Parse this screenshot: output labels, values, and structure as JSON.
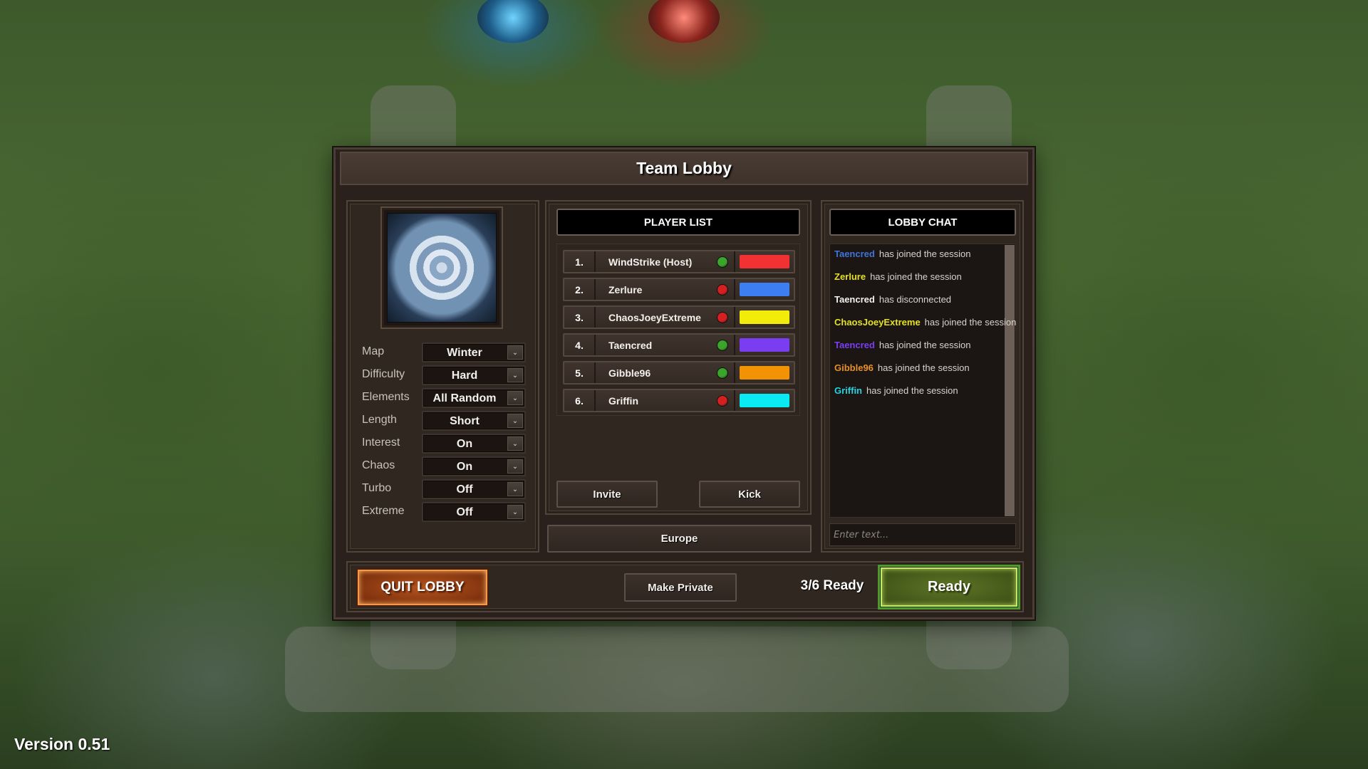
{
  "window": {
    "title": "Team Lobby"
  },
  "map_preview": {
    "name": "Winter"
  },
  "settings": [
    {
      "label": "Map",
      "value": "Winter"
    },
    {
      "label": "Difficulty",
      "value": "Hard"
    },
    {
      "label": "Elements",
      "value": "All Random"
    },
    {
      "label": "Length",
      "value": "Short"
    },
    {
      "label": "Interest",
      "value": "On"
    },
    {
      "label": "Chaos",
      "value": "On"
    },
    {
      "label": "Turbo",
      "value": "Off"
    },
    {
      "label": "Extreme",
      "value": "Off"
    }
  ],
  "player_list": {
    "header": "PLAYER LIST",
    "players": [
      {
        "num": "1.",
        "name": "WindStrike (Host)",
        "ready": true,
        "status_color": "#3aa52a",
        "team_color": "#f23232"
      },
      {
        "num": "2.",
        "name": "Zerlure",
        "ready": false,
        "status_color": "#d42020",
        "team_color": "#3d7ef2"
      },
      {
        "num": "3.",
        "name": "ChaosJoeyExtreme",
        "ready": false,
        "status_color": "#d42020",
        "team_color": "#f2ec0a"
      },
      {
        "num": "4.",
        "name": "Taencred",
        "ready": true,
        "status_color": "#3aa52a",
        "team_color": "#7a3df2"
      },
      {
        "num": "5.",
        "name": "Gibble96",
        "ready": true,
        "status_color": "#3aa52a",
        "team_color": "#f29205"
      },
      {
        "num": "6.",
        "name": "Griffin",
        "ready": false,
        "status_color": "#d42020",
        "team_color": "#0aeaf2"
      }
    ],
    "invite_label": "Invite",
    "kick_label": "Kick"
  },
  "region": "Europe",
  "chat": {
    "header": "LOBBY CHAT",
    "messages": [
      {
        "user": "Taencred",
        "user_color": "#3f74d8",
        "text": "has joined the session"
      },
      {
        "user": "Zerlure",
        "user_color": "#e4e024",
        "text": "has joined the session"
      },
      {
        "user": "Taencred",
        "user_color": "#f2f2f2",
        "text": "has disconnected"
      },
      {
        "user": "ChaosJoeyExtreme",
        "user_color": "#e4e024",
        "text": "has joined the session"
      },
      {
        "user": "Taencred",
        "user_color": "#7a3df2",
        "text": "has joined the session"
      },
      {
        "user": "Gibble96",
        "user_color": "#e8902a",
        "text": "has joined the session"
      },
      {
        "user": "Griffin",
        "user_color": "#24d4e0",
        "text": "has joined the session"
      }
    ],
    "input_placeholder": "Enter text...",
    "input_value": ""
  },
  "footer": {
    "quit_label": "QUIT LOBBY",
    "private_label": "Make Private",
    "ready_count": "3/6 Ready",
    "ready_label": "Ready"
  },
  "version": "Version 0.51"
}
